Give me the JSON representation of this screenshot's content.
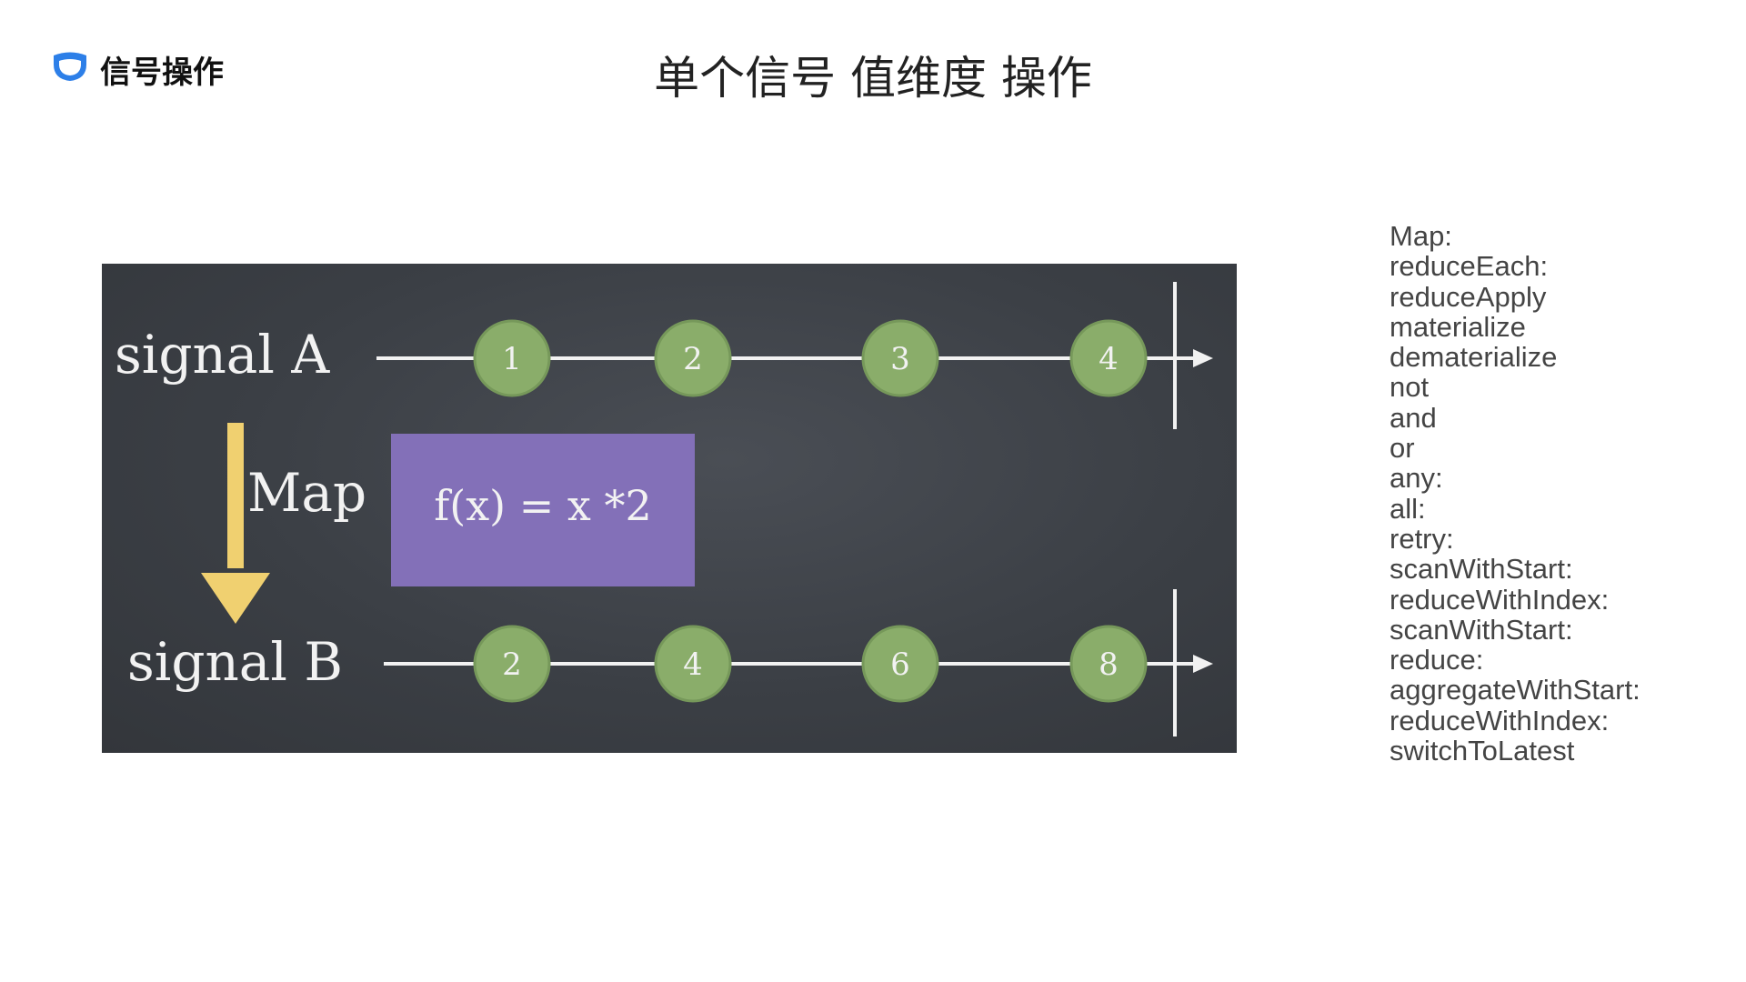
{
  "header": {
    "brand": "信号操作",
    "title": "单个信号 值维度 操作"
  },
  "diagram": {
    "signal_a_label": "signal A",
    "signal_b_label": "signal B",
    "operator_label": "Map",
    "function_label": "f(x) = x *2",
    "signal_a_values": [
      "1",
      "2",
      "3",
      "4"
    ],
    "signal_b_values": [
      "2",
      "4",
      "6",
      "8"
    ],
    "colors": {
      "board": "#3b3f45",
      "marble": "#8aad6a",
      "function_box": "#8370b8",
      "arrow": "#f0d070",
      "chalk": "#f2f2f2"
    }
  },
  "operators": [
    "Map:",
    "reduceEach:",
    "reduceApply",
    "materialize",
    "dematerialize",
    "not",
    "and",
    "or",
    "any:",
    "all:",
    "retry:",
    "scanWithStart:",
    "reduceWithIndex:",
    "scanWithStart:",
    "reduce:",
    "aggregateWithStart:",
    "reduceWithIndex:",
    "switchToLatest"
  ]
}
